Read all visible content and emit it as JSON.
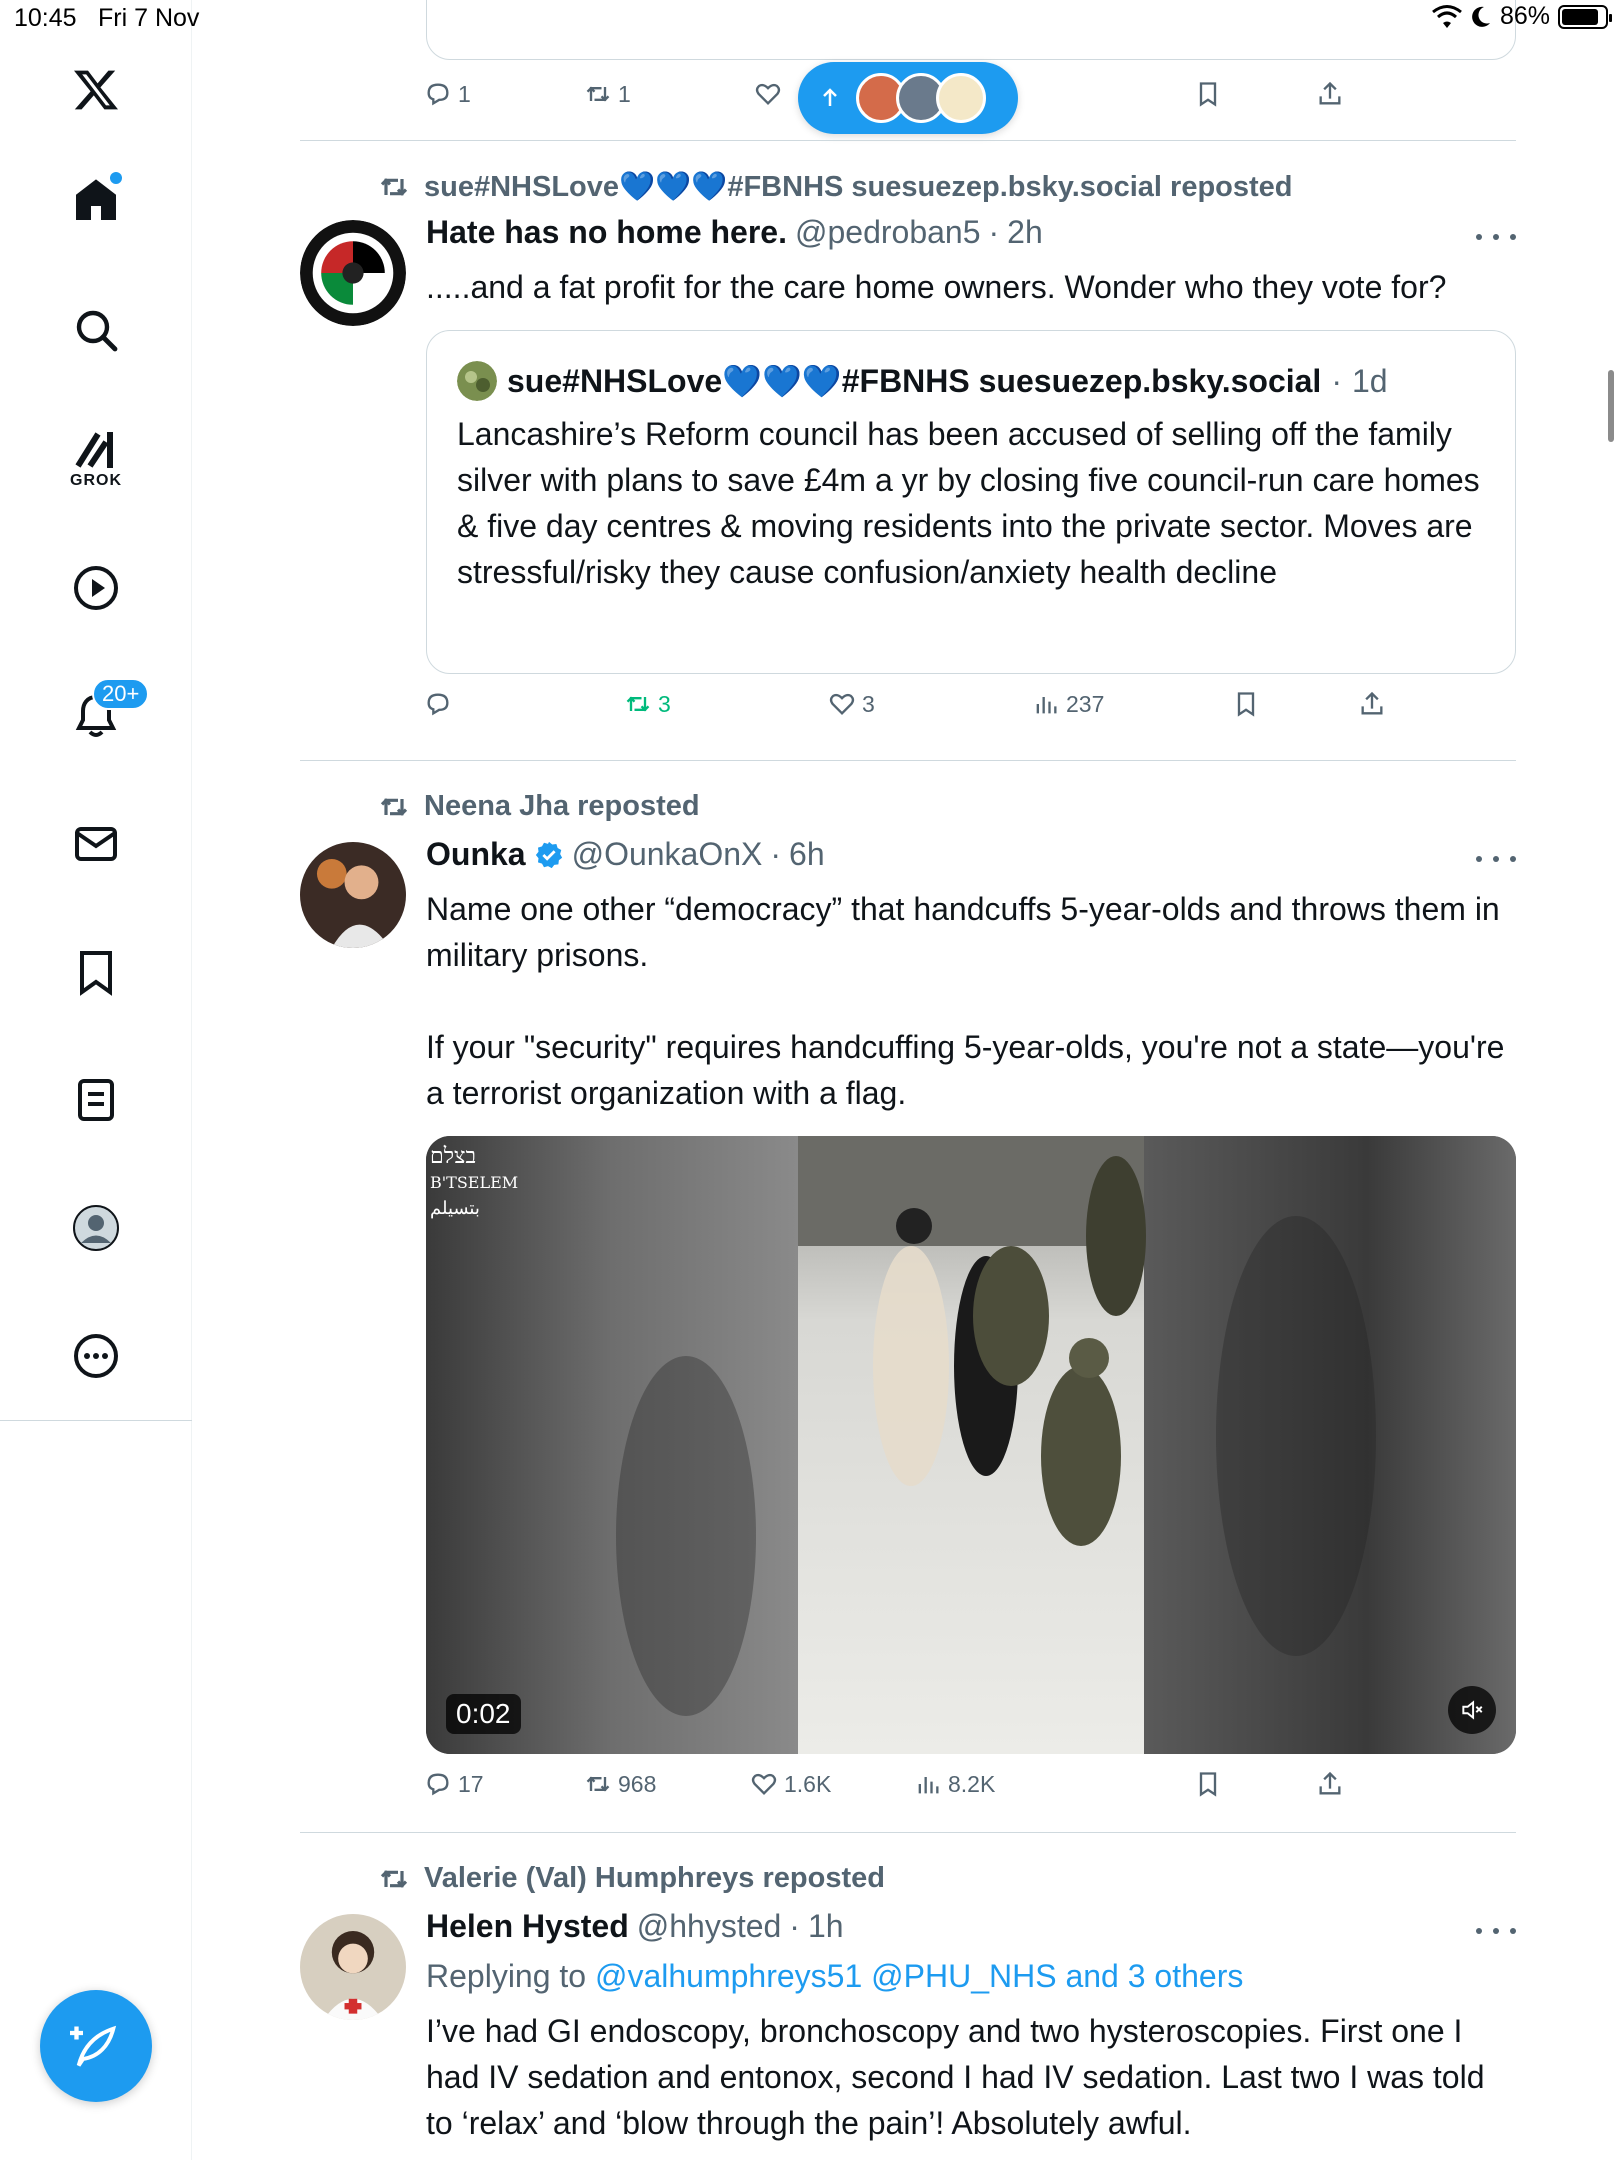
{
  "status_bar": {
    "time": "10:45",
    "date": "Fri 7 Nov",
    "battery": "86%"
  },
  "sidebar": {
    "notifications_badge": "20+",
    "grok_label": "GROK"
  },
  "top_partial": {
    "action_counts": {
      "replies": "1",
      "reposts": "1"
    }
  },
  "posts": [
    {
      "repost_by": "sue#NHSLove💙💙💙#FBNHS suesuezep.bsky.social reposted",
      "name": "Hate has no home here.",
      "handle": "@pedroban5",
      "sep": "·",
      "time": "2h",
      "text": ".....and a fat profit for the care home owners. Wonder who they vote for?",
      "quote": {
        "name": "sue#NHSLove💙💙💙#FBNHS suesuezep.bsky.social",
        "sep": "·",
        "time": "1d",
        "text": "Lancashire’s Reform council has been accused of selling off the family silver with plans to save £4m a yr by closing five council-run care homes & five day centres & moving residents into the private sector. Moves are stressful/risky they cause confusion/anxiety health decline"
      },
      "counts": {
        "replies": "",
        "reposts": "3",
        "likes": "3",
        "views": "237"
      }
    },
    {
      "repost_by": "Neena Jha reposted",
      "name": "Ounka",
      "handle": "@OunkaOnX",
      "sep": "·",
      "time": "6h",
      "text": "Name one other “democracy” that handcuffs 5-year-olds and throws them in military prisons.\n\nIf your \"security\" requires handcuffing 5-year-olds, you're not a state—you're a terrorist organization with a flag.",
      "media": {
        "duration": "0:02",
        "logo_line1": "בצלם",
        "logo_line2": "B'TSELEM",
        "logo_line3": "بتسيلم"
      },
      "counts": {
        "replies": "17",
        "reposts": "968",
        "likes": "1.6K",
        "views": "8.2K"
      }
    },
    {
      "repost_by": "Valerie (Val) Humphreys reposted",
      "name": "Helen Hysted",
      "handle": "@hhysted",
      "sep": "·",
      "time": "1h",
      "reply_prefix": "Replying to ",
      "reply_users": "@valhumphreys51 @PHU_NHS and 3 others",
      "text": "I’ve had GI endoscopy, bronchoscopy and two hysteroscopies. First one I had IV sedation and entonox, second I had IV sedation. Last two I was told to ‘relax’ and ‘blow through the pain’! Absolutely awful."
    }
  ],
  "colors": {
    "accent": "#1d9bf0",
    "repost_green": "#00ba7c",
    "secondary": "#536471"
  }
}
